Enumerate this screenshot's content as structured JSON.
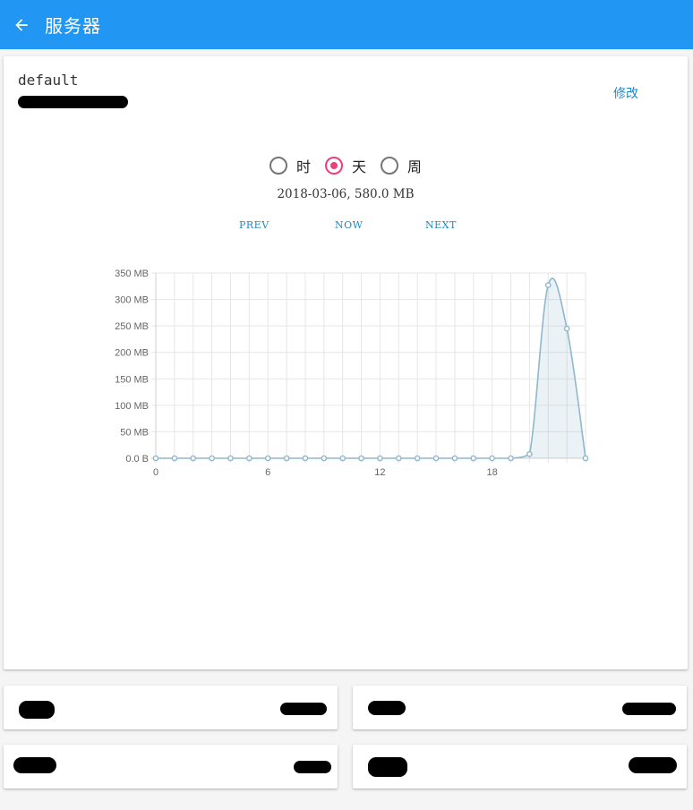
{
  "appbar": {
    "title": "服务器",
    "back_icon": "arrow-left-icon",
    "color": "#2196f3"
  },
  "server": {
    "name": "default",
    "edit_label": "修改"
  },
  "range_options": [
    {
      "label": "时",
      "selected": false
    },
    {
      "label": "天",
      "selected": true
    },
    {
      "label": "周",
      "selected": false
    }
  ],
  "status_text": "2018-03-06, 580.0 MB",
  "nav": {
    "prev": "PREV",
    "now": "NOW",
    "next": "NEXT"
  },
  "chart_data": {
    "type": "area",
    "title": "",
    "xlabel": "",
    "ylabel": "",
    "x": [
      0,
      1,
      2,
      3,
      4,
      5,
      6,
      7,
      8,
      9,
      10,
      11,
      12,
      13,
      14,
      15,
      16,
      17,
      18,
      19,
      20,
      21,
      22,
      23
    ],
    "x_ticks": [
      0,
      6,
      12,
      18
    ],
    "y_ticks": [
      0,
      50,
      100,
      150,
      200,
      250,
      300,
      350
    ],
    "y_tick_labels": [
      "0.0 B",
      "50 MB",
      "100 MB",
      "150 MB",
      "200 MB",
      "250 MB",
      "300 MB",
      "350 MB"
    ],
    "xlim": [
      0,
      23
    ],
    "ylim": [
      0,
      350
    ],
    "grid": true,
    "series": [
      {
        "values": [
          0,
          0,
          0,
          0,
          0,
          0,
          0,
          0,
          0,
          0,
          0,
          0,
          0,
          0,
          0,
          0,
          0,
          0,
          0,
          0,
          8,
          327,
          245,
          0
        ],
        "color": "#8fb7cd"
      }
    ]
  }
}
